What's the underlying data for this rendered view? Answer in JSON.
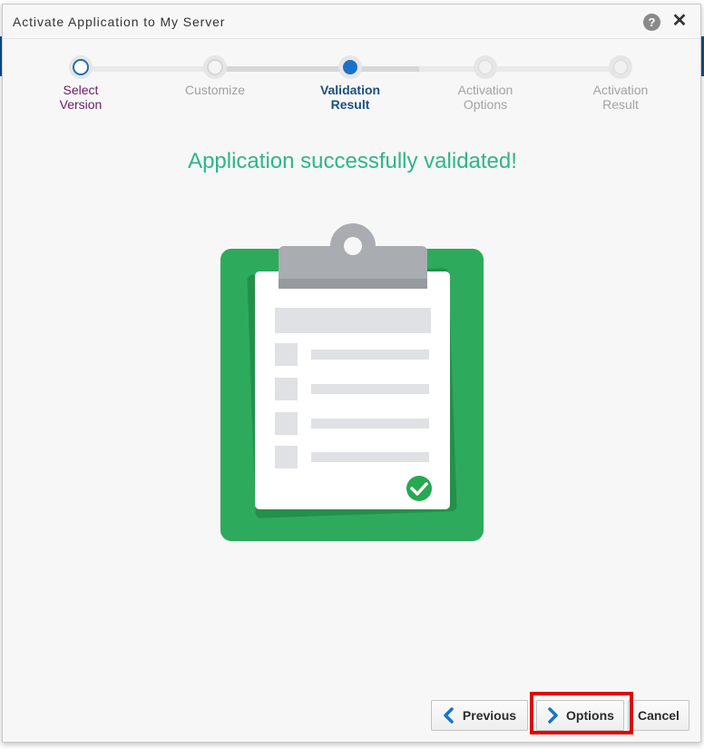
{
  "dialog": {
    "title": "Activate Application to My Server",
    "help_symbol": "?",
    "close_symbol": "✕"
  },
  "train": {
    "steps": [
      {
        "line1": "Select",
        "line2": "Version",
        "state": "visited"
      },
      {
        "line1": "Customize",
        "line2": "",
        "state": "plain"
      },
      {
        "line1": "Validation",
        "line2": "Result",
        "state": "current"
      },
      {
        "line1": "Activation",
        "line2": "Options",
        "state": "future"
      },
      {
        "line1": "Activation",
        "line2": "Result",
        "state": "future"
      }
    ]
  },
  "content": {
    "headline": "Application successfully validated!",
    "illustration_icon": "clipboard-checklist-icon",
    "colors": {
      "headline": "#2eb58a",
      "clipboard_board": "#2eaa5c",
      "check_badge": "#27a852",
      "accent_blue": "#1a72c7",
      "highlight_box": "#e00000"
    }
  },
  "footer": {
    "previous_label": "Previous",
    "next_label": "Options",
    "cancel_label": "Cancel"
  }
}
